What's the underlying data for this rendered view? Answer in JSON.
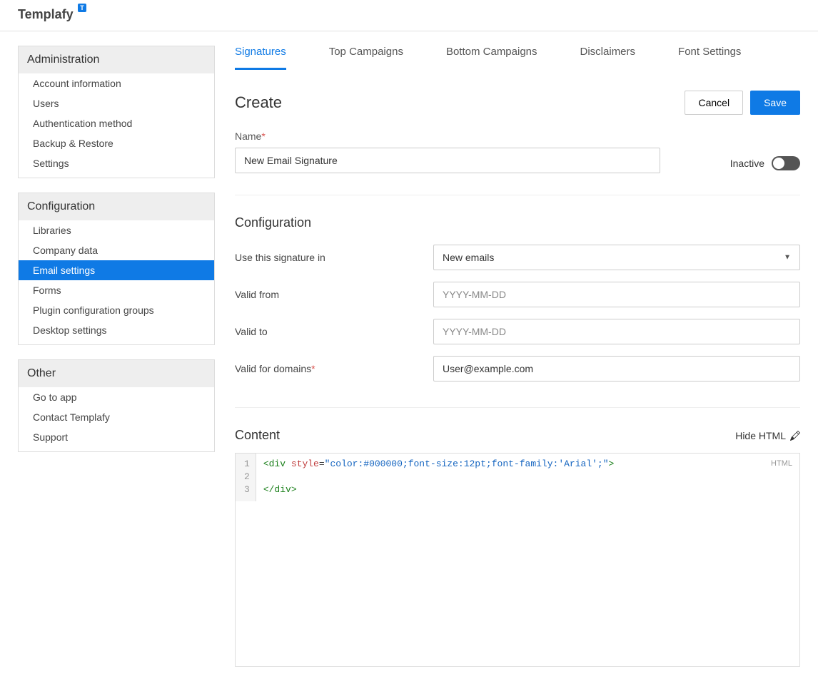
{
  "header": {
    "logo": "Templafy",
    "badge": "T"
  },
  "sidebar": {
    "sections": [
      {
        "title": "Administration",
        "items": [
          "Account information",
          "Users",
          "Authentication method",
          "Backup & Restore",
          "Settings"
        ],
        "active": -1
      },
      {
        "title": "Configuration",
        "items": [
          "Libraries",
          "Company data",
          "Email settings",
          "Forms",
          "Plugin configuration groups",
          "Desktop settings"
        ],
        "active": 2
      },
      {
        "title": "Other",
        "items": [
          "Go to app",
          "Contact Templafy",
          "Support"
        ],
        "active": -1
      }
    ]
  },
  "tabs": {
    "items": [
      "Signatures",
      "Top Campaigns",
      "Bottom Campaigns",
      "Disclaimers",
      "Font Settings"
    ],
    "active": 0
  },
  "page": {
    "title": "Create",
    "cancel": "Cancel",
    "save": "Save"
  },
  "form": {
    "name_label": "Name",
    "name_value": "New Email Signature",
    "inactive_label": "Inactive",
    "config_title": "Configuration",
    "use_in_label": "Use this signature in",
    "use_in_value": "New emails",
    "valid_from_label": "Valid from",
    "valid_from_placeholder": "YYYY-MM-DD",
    "valid_to_label": "Valid to",
    "valid_to_placeholder": "YYYY-MM-DD",
    "domains_label": "Valid for domains",
    "domains_value": "User@example.com",
    "content_title": "Content",
    "hide_html": "Hide HTML",
    "code_badge": "HTML",
    "code": {
      "lines": [
        "1",
        "2",
        "3"
      ],
      "line1_tag_open": "<div",
      "line1_attr": "style",
      "line1_eq": "=",
      "line1_string": "\"color:#000000;font-size:12pt;font-family:'Arial';\"",
      "line1_tag_close": ">",
      "line3": "</div>"
    }
  }
}
